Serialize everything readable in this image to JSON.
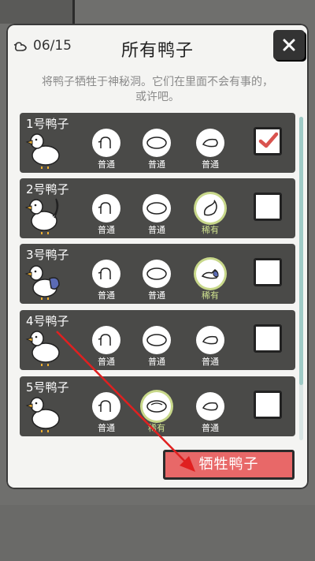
{
  "header": {
    "counter": "06/15",
    "title": "所有鸭子",
    "close_icon": "close-icon",
    "subtitle_line1": "将鸭子牺牲于神秘洞。它们在里面不会有事的，",
    "subtitle_line2": "或许吧。"
  },
  "ducks": [
    {
      "name": "1号鸭子",
      "traits": [
        "普通",
        "普通",
        "普通"
      ],
      "checked": true
    },
    {
      "name": "2号鸭子",
      "traits": [
        "普通",
        "普通",
        "稀有"
      ],
      "checked": false
    },
    {
      "name": "3号鸭子",
      "traits": [
        "普通",
        "普通",
        "稀有"
      ],
      "checked": false
    },
    {
      "name": "4号鸭子",
      "traits": [
        "普通",
        "普通",
        "普通"
      ],
      "checked": false
    },
    {
      "name": "5号鸭子",
      "traits": [
        "普通",
        "稀有",
        "普通"
      ],
      "checked": false
    }
  ],
  "action": {
    "sacrifice_label": "牺牲鸭子"
  },
  "colors": {
    "button": "#e86868",
    "card": "#4a4a48",
    "rare": "#cfe28f",
    "check": "#d9534f"
  }
}
